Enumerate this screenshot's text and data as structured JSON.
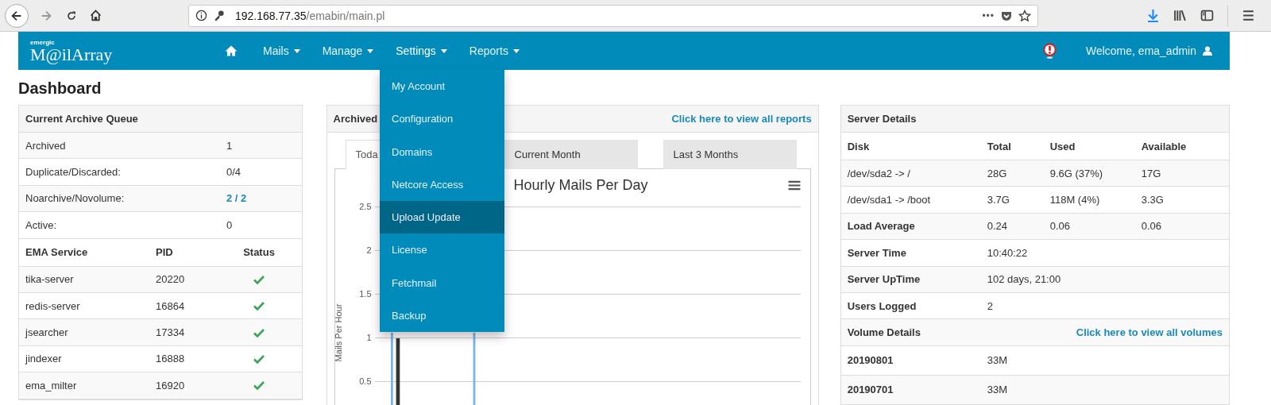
{
  "browser": {
    "url_host": "192.168.77.35",
    "url_path": "/emabin/main.pl",
    "more": "•••"
  },
  "navbar": {
    "logo_small": "emergic",
    "logo": "M@ilArray",
    "menus": [
      {
        "label": "Mails",
        "expanded": false
      },
      {
        "label": "Manage",
        "expanded": false
      },
      {
        "label": "Settings",
        "expanded": true
      },
      {
        "label": "Reports",
        "expanded": false
      }
    ],
    "welcome": "Welcome, ema_admin"
  },
  "settings_menu": [
    {
      "label": "My Account",
      "selected": false
    },
    {
      "label": "Configuration",
      "selected": false
    },
    {
      "label": "Domains",
      "selected": false
    },
    {
      "label": "Netcore Access",
      "selected": false
    },
    {
      "label": "Upload Update",
      "selected": true
    },
    {
      "label": "License",
      "selected": false
    },
    {
      "label": "Fetchmail",
      "selected": false
    },
    {
      "label": "Backup",
      "selected": false
    }
  ],
  "page_title": "Dashboard",
  "queue": {
    "title": "Current Archive Queue",
    "rows": [
      {
        "label": "Archived",
        "value": "1",
        "link": false
      },
      {
        "label": "Duplicate/Discarded:",
        "value": "0/4",
        "link": false
      },
      {
        "label": "Noarchive/Novolume:",
        "value": "2 / 2",
        "link": true
      },
      {
        "label": "Active:",
        "value": "0",
        "link": false
      }
    ],
    "service_columns": [
      "EMA Service",
      "PID",
      "Status"
    ],
    "services": [
      {
        "name": "tika-server",
        "pid": "20220",
        "running": true
      },
      {
        "name": "redis-server",
        "pid": "16864",
        "running": true
      },
      {
        "name": "jsearcher",
        "pid": "17334",
        "running": true
      },
      {
        "name": "jindexer",
        "pid": "16888",
        "running": true
      },
      {
        "name": "ema_milter",
        "pid": "16920",
        "running": true
      }
    ]
  },
  "reports": {
    "title": "Archived",
    "link": "Click here to view all reports",
    "tabs": [
      {
        "label": "Toda",
        "selected": true
      },
      {
        "label": "Current Month",
        "selected": false
      },
      {
        "label": "Last 3 Months",
        "selected": false
      }
    ],
    "chart": {
      "title": "Hourly Mails Per Day",
      "ylabel": "Mails Per Hour",
      "yticks": [
        "2.5",
        "2",
        "1.5",
        "1",
        "0.5"
      ]
    }
  },
  "server": {
    "title": "Server Details",
    "columns": [
      "Disk",
      "Total",
      "Used",
      "Available"
    ],
    "disks": [
      [
        "/dev/sda2 -> /",
        "28G",
        "9.6G (37%)",
        "17G"
      ],
      [
        "/dev/sda1 -> /boot",
        "3.7G",
        "118M (4%)",
        "3.3G"
      ]
    ],
    "load": {
      "label": "Load Average",
      "values": [
        "0.24",
        "0.06",
        "0.06"
      ]
    },
    "info": [
      {
        "label": "Server Time",
        "value": "10:40:22"
      },
      {
        "label": "Server UpTime",
        "value": "102 days, 21:00"
      },
      {
        "label": "Users Logged",
        "value": "2"
      }
    ],
    "volume_title": "Volume Details",
    "volume_link": "Click here to view all volumes",
    "volumes": [
      {
        "name": "20190801",
        "size": "33M"
      },
      {
        "name": "20190701",
        "size": "33M"
      }
    ]
  }
}
